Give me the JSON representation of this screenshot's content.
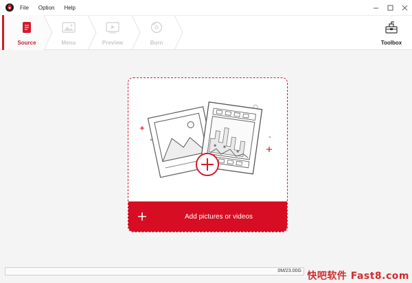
{
  "menu": {
    "items": [
      "File",
      "Option",
      "Help"
    ]
  },
  "steps": [
    {
      "label": "Source",
      "icon": "document-icon",
      "active": true
    },
    {
      "label": "Menu",
      "icon": "menu-picture-icon",
      "active": false
    },
    {
      "label": "Preview",
      "icon": "play-icon",
      "active": false
    },
    {
      "label": "Burn",
      "icon": "disc-icon",
      "active": false
    }
  ],
  "toolbox": {
    "label": "Toolbox",
    "icon": "toolbox-icon"
  },
  "dropzone": {
    "add_label": "Add pictures or videos"
  },
  "status": {
    "capacity_text": "0M/23.00G",
    "used_fraction": 0
  },
  "watermark": {
    "text": "快吧软件 Fast8.com"
  },
  "colors": {
    "accent": "#d60d23",
    "inactive": "#c9c9c9"
  }
}
